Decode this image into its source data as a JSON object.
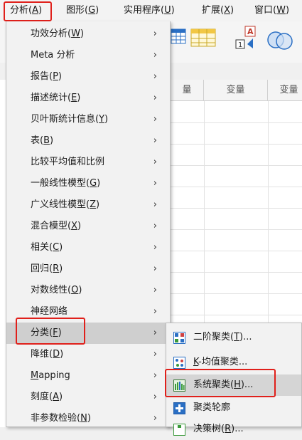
{
  "menubar": {
    "items": [
      {
        "label": "分析(",
        "key": "A",
        "tail": ")"
      },
      {
        "label": "图形(",
        "key": "G",
        "tail": ")"
      },
      {
        "label": "实用程序(",
        "key": "U",
        "tail": ")"
      },
      {
        "label": "扩展(",
        "key": "X",
        "tail": ")"
      },
      {
        "label": "窗口(",
        "key": "W",
        "tail": ")"
      }
    ]
  },
  "grid": {
    "columns": [
      "量",
      "变量",
      "变量"
    ]
  },
  "analyze_menu": {
    "items": [
      {
        "pre": "功效分析(",
        "key": "W",
        "post": ")"
      },
      {
        "pre": "Meta 分析",
        "key": "",
        "post": ""
      },
      {
        "pre": "报告(",
        "key": "P",
        "post": ")"
      },
      {
        "pre": "描述统计(",
        "key": "E",
        "post": ")"
      },
      {
        "pre": "贝叶斯统计信息(",
        "key": "Y",
        "post": ")"
      },
      {
        "pre": "表(",
        "key": "B",
        "post": ")"
      },
      {
        "pre": "比较平均值和比例",
        "key": "",
        "post": ""
      },
      {
        "pre": "一般线性模型(",
        "key": "G",
        "post": ")"
      },
      {
        "pre": "广义线性模型(",
        "key": "Z",
        "post": ")"
      },
      {
        "pre": "混合模型(",
        "key": "X",
        "post": ")"
      },
      {
        "pre": "相关(",
        "key": "C",
        "post": ")"
      },
      {
        "pre": "回归(",
        "key": "R",
        "post": ")"
      },
      {
        "pre": "对数线性(",
        "key": "O",
        "post": ")"
      },
      {
        "pre": "神经网络",
        "key": "",
        "post": ""
      },
      {
        "pre": "分类(",
        "key": "F",
        "post": ")"
      },
      {
        "pre": "降维(",
        "key": "D",
        "post": ")"
      },
      {
        "pre": "",
        "key": "M",
        "post": "apping"
      },
      {
        "pre": "刻度(",
        "key": "A",
        "post": ")"
      },
      {
        "pre": "非参数检验(",
        "key": "N",
        "post": ")"
      }
    ],
    "arrow": "›"
  },
  "classify_submenu": {
    "items": [
      {
        "pre": "二阶聚类(",
        "key": "T",
        "post": ")..."
      },
      {
        "pre": "",
        "key": "K",
        "post": "-均值聚类..."
      },
      {
        "pre": "系统聚类(",
        "key": "H",
        "post": ")..."
      },
      {
        "pre": "聚类轮廓",
        "key": "",
        "post": ""
      },
      {
        "pre": "决策树(",
        "key": "R",
        "post": ")..."
      }
    ]
  },
  "colors": {
    "highlight_border": "#e0201b",
    "menu_bg": "#f2f2f2",
    "active_bg": "#cfcfcf"
  }
}
